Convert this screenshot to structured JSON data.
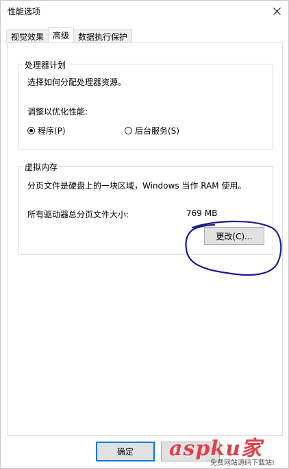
{
  "window": {
    "title": "性能选项",
    "close_glyph": "close-icon"
  },
  "tabs": [
    {
      "label": "视觉效果",
      "active": false
    },
    {
      "label": "高级",
      "active": true
    },
    {
      "label": "数据执行保护",
      "active": false
    }
  ],
  "processor": {
    "legend": "处理器计划",
    "description": "选择如何分配处理器资源。",
    "adjust_label": "调整以优化性能:",
    "options": [
      {
        "label": "程序(P)",
        "selected": true
      },
      {
        "label": "后台服务(S)",
        "selected": false
      }
    ]
  },
  "virtual_memory": {
    "legend": "虚拟内存",
    "description": "分页文件是硬盘上的一块区域，Windows 当作 RAM 使用。",
    "total_label": "所有驱动器总分页文件大小:",
    "total_value": "769 MB",
    "change_button": "更改(C)..."
  },
  "footer": {
    "ok_button": "确定",
    "cancel_button": ""
  },
  "annotation": {
    "color": "#1a1a8c"
  },
  "watermark": {
    "brand": "aspku",
    "brand_suffix": "家",
    "sub": "免费网站源码下载站!"
  }
}
